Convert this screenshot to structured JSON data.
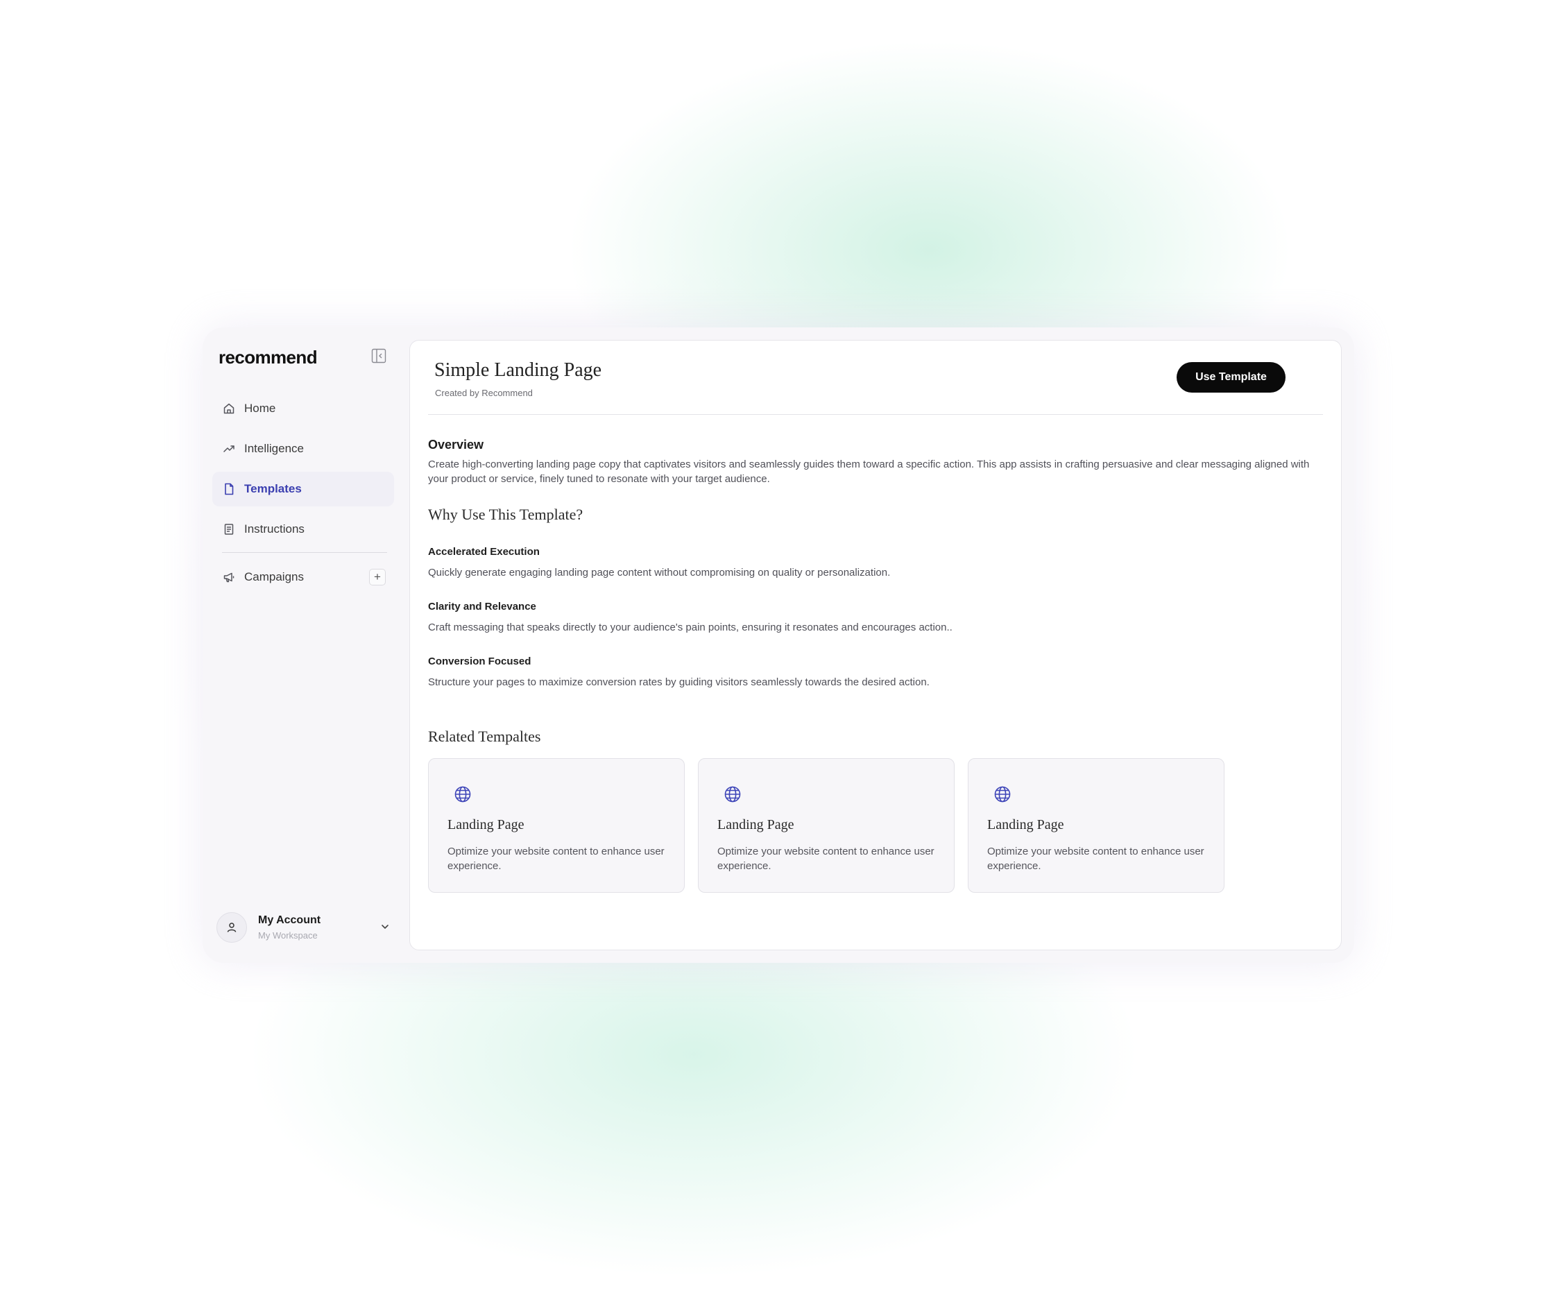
{
  "sidebar": {
    "logo": "recommend",
    "nav": [
      {
        "label": "Home",
        "icon": "home-icon"
      },
      {
        "label": "Intelligence",
        "icon": "trending-up-icon"
      },
      {
        "label": "Templates",
        "icon": "file-icon",
        "active": true
      },
      {
        "label": "Instructions",
        "icon": "book-icon"
      }
    ],
    "campaigns": {
      "label": "Campaigns",
      "icon": "megaphone-icon",
      "add_label": "+"
    },
    "account": {
      "name": "My Account",
      "workspace": "My Workspace"
    }
  },
  "main": {
    "title": "Simple Landing Page",
    "subtitle": "Created by Recommend",
    "use_button": "Use Template",
    "overview": {
      "heading": "Overview",
      "text": "Create high-converting landing page copy that captivates visitors and seamlessly guides them toward a specific action. This app assists in crafting persuasive and clear messaging aligned with your product or service, finely tuned to resonate with your target audience."
    },
    "why": {
      "heading": "Why Use This Template?",
      "features": [
        {
          "title": "Accelerated Execution",
          "text": "Quickly generate engaging landing page content without compromising on quality or personalization."
        },
        {
          "title": "Clarity and Relevance",
          "text": "Craft messaging that speaks directly to your audience's pain points, ensuring it resonates and encourages action.."
        },
        {
          "title": "Conversion Focused",
          "text": "Structure your pages to maximize conversion rates by guiding visitors seamlessly towards the desired action."
        }
      ]
    },
    "related": {
      "heading": "Related Tempaltes",
      "cards": [
        {
          "title": "Landing Page",
          "text": "Optimize your website content to enhance user experience.",
          "icon": "globe-icon"
        },
        {
          "title": "Landing Page",
          "text": "Optimize your website content to enhance user experience.",
          "icon": "globe-icon"
        },
        {
          "title": "Landing Page",
          "text": "Optimize your website content to enhance user experience.",
          "icon": "globe-icon"
        }
      ]
    }
  },
  "colors": {
    "accent": "#3b3fb0",
    "button_bg": "#0a0a0a",
    "icon_blue": "#3d44b8"
  }
}
